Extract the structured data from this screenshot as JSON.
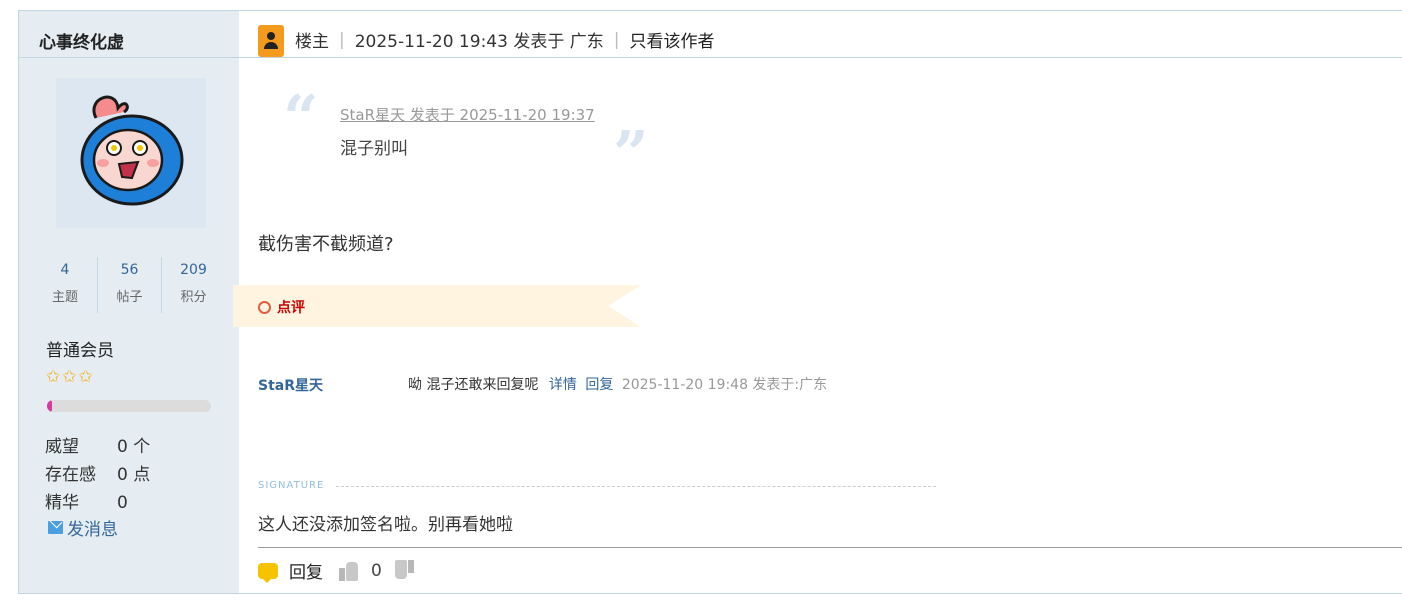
{
  "author": {
    "name": "心事终化虚",
    "stats": [
      {
        "value": "4",
        "label": "主题"
      },
      {
        "value": "56",
        "label": "帖子"
      },
      {
        "value": "209",
        "label": "积分"
      }
    ],
    "group": "普通会员",
    "stars": 3,
    "progress": 0.03,
    "attributes": [
      {
        "key": "威望",
        "value": "0 个"
      },
      {
        "key": "存在感",
        "value": "0 点"
      },
      {
        "key": "精华",
        "value": "0"
      }
    ],
    "message_label": "发消息"
  },
  "post": {
    "floor_label": "楼主",
    "timestamp": "2025-11-20 19:43 发表于 广东",
    "only_author": "只看该作者",
    "quote": {
      "meta": "StaR星天 发表于 2025-11-20 19:37",
      "text": "混子别叫"
    },
    "text": "截伤害不截频道?",
    "comment_section_label": "点评",
    "comment": {
      "user": "StaR星天",
      "text": "呦 混子还敢来回复呢",
      "detail_link": "详情",
      "reply_link": "回复",
      "time": "2025-11-20 19:48 发表于:广东"
    },
    "signature_label": "SIGNATURE",
    "signature": "这人还没添加签名啦。别再看她啦"
  },
  "footer": {
    "reply_label": "回复",
    "vote_count": "0"
  },
  "colors": {
    "link": "#336699",
    "sidebar_bg": "#e5edf2",
    "accent_orange": "#f49a1c",
    "comment_red": "#cc0000"
  }
}
